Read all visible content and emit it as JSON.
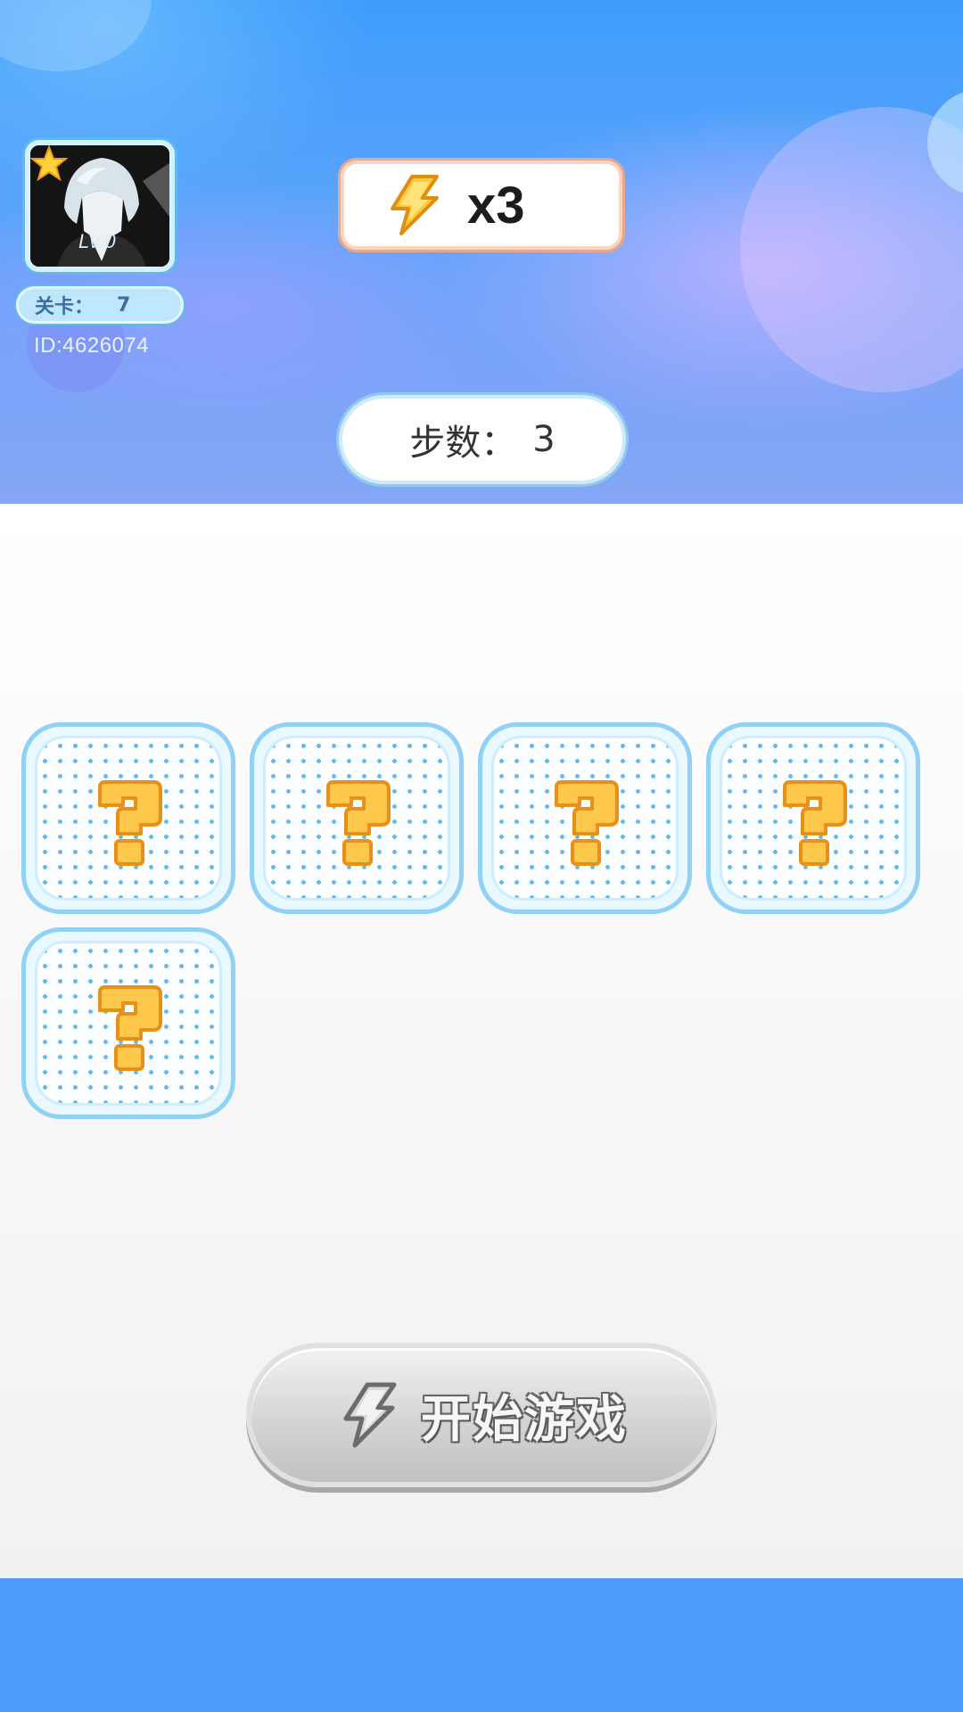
{
  "player": {
    "level_text": "Lv:0",
    "stage_label": "关卡：",
    "stage_value": "7",
    "id_text": "ID:4626074"
  },
  "energy": {
    "icon": "lightning-icon",
    "value": "x3"
  },
  "steps": {
    "label": "步数：",
    "value": "3"
  },
  "board": {
    "cards": [
      {
        "icon": "question-mark-icon",
        "state": "face-down"
      },
      {
        "icon": "question-mark-icon",
        "state": "face-down"
      },
      {
        "icon": "question-mark-icon",
        "state": "face-down"
      },
      {
        "icon": "question-mark-icon",
        "state": "face-down"
      },
      {
        "icon": "question-mark-icon",
        "state": "face-down"
      }
    ]
  },
  "start_button": {
    "label": "开始游戏",
    "icon": "lightning-icon",
    "state": "disabled"
  },
  "colors": {
    "header_blue": "#4a9efb",
    "card_border": "#8fd2f6",
    "question_orange": "#f6a623",
    "button_gray": "#cfcfcf"
  }
}
